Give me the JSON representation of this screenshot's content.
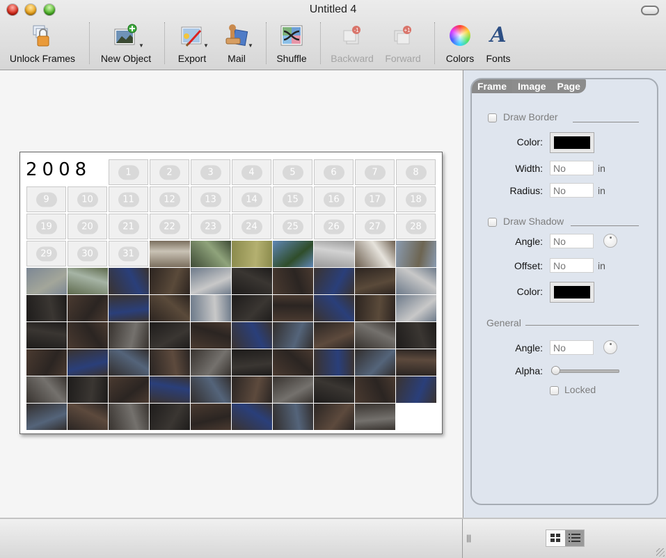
{
  "window": {
    "title": "Untitled 4"
  },
  "toolbar": {
    "items": [
      {
        "label": "Unlock Frames",
        "icon": "lock-icon",
        "enabled": true
      },
      {
        "label": "New Object",
        "icon": "new-object-icon",
        "enabled": true,
        "menu": true
      },
      {
        "label": "Export",
        "icon": "export-icon",
        "enabled": true,
        "menu": true
      },
      {
        "label": "Mail",
        "icon": "mail-stamp-icon",
        "enabled": true,
        "menu": true
      },
      {
        "label": "Shuffle",
        "icon": "shuffle-icon",
        "enabled": true
      },
      {
        "label": "Backward",
        "icon": "backward-icon",
        "enabled": false,
        "badge": "-1"
      },
      {
        "label": "Forward",
        "icon": "forward-icon",
        "enabled": false,
        "badge": "+1"
      },
      {
        "label": "Colors",
        "icon": "color-wheel-icon",
        "enabled": true
      },
      {
        "label": "Fonts",
        "icon": "fonts-icon",
        "enabled": true,
        "glyph": "A"
      }
    ]
  },
  "calendar": {
    "year": "2008",
    "days": [
      "1",
      "2",
      "3",
      "4",
      "5",
      "6",
      "7",
      "8",
      "9",
      "10",
      "11",
      "12",
      "13",
      "14",
      "15",
      "16",
      "17",
      "18",
      "19",
      "20",
      "21",
      "22",
      "23",
      "24",
      "25",
      "26",
      "27",
      "28",
      "29",
      "30",
      "31"
    ],
    "photo_count": 66
  },
  "inspector": {
    "tabs": [
      {
        "label": "Frame",
        "active": true
      },
      {
        "label": "Image",
        "active": false
      },
      {
        "label": "Page",
        "active": false
      }
    ],
    "draw_border": {
      "label": "Draw Border",
      "checked": false,
      "color_label": "Color:",
      "color": "#000000",
      "width_label": "Width:",
      "width_value": "No",
      "width_unit": "in",
      "radius_label": "Radius:",
      "radius_value": "No",
      "radius_unit": "in"
    },
    "draw_shadow": {
      "label": "Draw Shadow",
      "checked": false,
      "angle_label": "Angle:",
      "angle_value": "No",
      "offset_label": "Offset:",
      "offset_value": "No",
      "offset_unit": "in",
      "color_label": "Color:",
      "color": "#000000"
    },
    "general": {
      "label": "General",
      "angle_label": "Angle:",
      "angle_value": "No",
      "alpha_label": "Alpha:",
      "alpha_value": 0,
      "locked_label": "Locked",
      "locked_checked": false
    }
  },
  "bottom": {
    "view_modes": [
      {
        "name": "grid",
        "selected": true
      },
      {
        "name": "list",
        "selected": false
      }
    ]
  }
}
